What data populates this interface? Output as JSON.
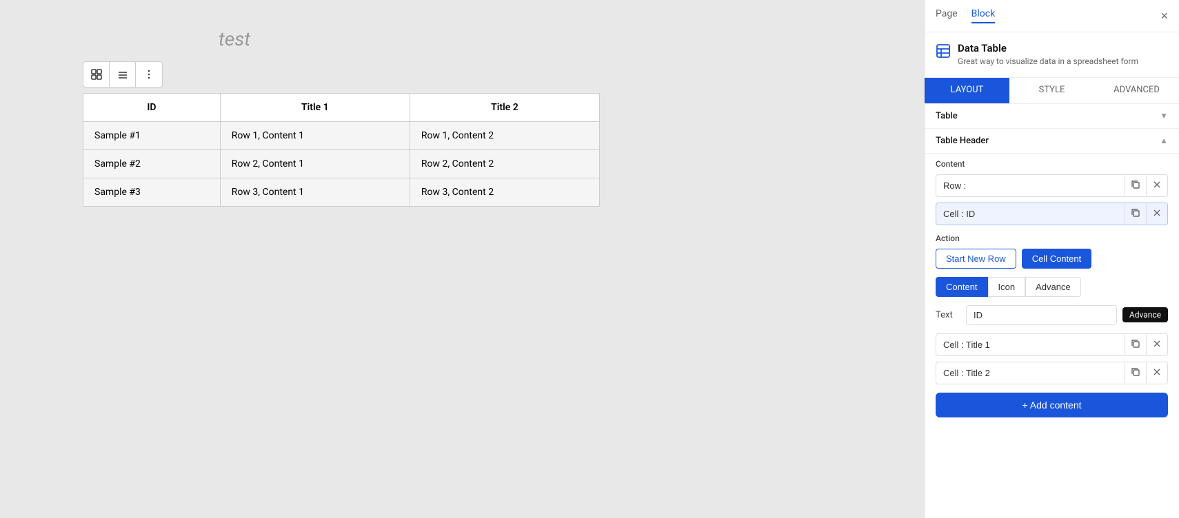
{
  "canvas": {
    "title": "test",
    "toolbar": {
      "grid_icon": "⊞",
      "lines_icon": "≡",
      "dots_icon": "⋮"
    },
    "table": {
      "headers": [
        "ID",
        "Title 1",
        "Title 2"
      ],
      "rows": [
        [
          "Sample #1",
          "Row 1, Content 1",
          "Row 1, Content 2"
        ],
        [
          "Sample #2",
          "Row 2, Content 1",
          "Row 2, Content 2"
        ],
        [
          "Sample #3",
          "Row 3, Content 1",
          "Row 3, Content 2"
        ]
      ]
    }
  },
  "panel": {
    "tabs": [
      {
        "label": "Page",
        "active": false
      },
      {
        "label": "Block",
        "active": true
      }
    ],
    "close_label": "×",
    "block_title": "Data Table",
    "block_desc": "Great way to visualize data in a spreadsheet form",
    "sub_tabs": [
      {
        "label": "LAYOUT",
        "active": true
      },
      {
        "label": "STYLE",
        "active": false
      },
      {
        "label": "ADVANCED",
        "active": false
      }
    ],
    "table_section": {
      "label": "Table",
      "collapsed": true
    },
    "table_header_section": {
      "label": "Table Header",
      "collapsed": false
    },
    "content_label": "Content",
    "row_label": "Row :",
    "cells": [
      {
        "label": "Cell : ID"
      },
      {
        "label": "Cell : Title 1"
      },
      {
        "label": "Cell : Title 2"
      }
    ],
    "action_label": "Action",
    "action_buttons": [
      {
        "label": "Start New Row",
        "primary": false
      },
      {
        "label": "Cell Content",
        "primary": true
      }
    ],
    "content_tabs": [
      {
        "label": "Content",
        "active": true
      },
      {
        "label": "Icon",
        "active": false
      },
      {
        "label": "Advance",
        "active": false
      }
    ],
    "text_label": "Text",
    "text_value": "ID",
    "advance_tooltip": "Advance",
    "add_content_label": "+ Add content"
  }
}
